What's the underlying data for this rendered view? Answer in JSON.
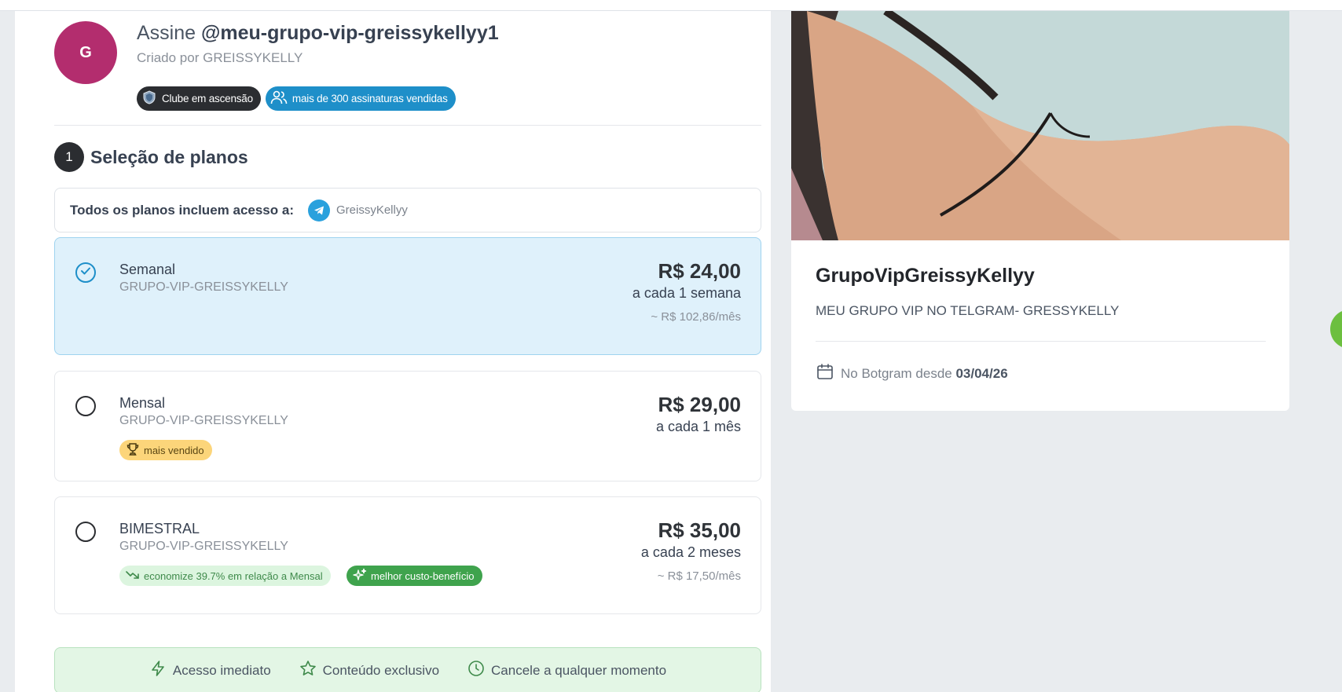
{
  "header": {
    "avatar_letter": "G",
    "title_prefix": "Assine ",
    "title_handle": "@meu-grupo-vip-greissykellyy1",
    "creator": "Criado por GREISSYKELLY",
    "badges": [
      {
        "label": "Clube em ascensão",
        "icon": "shield-icon",
        "color": "#2b2d31"
      },
      {
        "label": "mais de 300 assinaturas vendidas",
        "icon": "users-icon",
        "color": "#1e8fc9"
      }
    ]
  },
  "plans_section": {
    "step_number": "1",
    "title": "Seleção de planos",
    "access_label": "Todos os planos incluem acesso a:",
    "access_item": "GreissyKellyy",
    "access_icon": "telegram-icon"
  },
  "plans": [
    {
      "name": "Semanal",
      "group": "GRUPO-VIP-GREISSYKELLY",
      "price": "R$ 24,00",
      "period": "a cada 1 semana",
      "monthly": "~ R$ 102,86/mês",
      "selected": true
    },
    {
      "name": "Mensal",
      "group": "GRUPO-VIP-GREISSYKELLY",
      "price": "R$ 29,00",
      "period": "a cada 1 mês",
      "tag": "mais vendido",
      "selected": false
    },
    {
      "name": "BIMESTRAL",
      "group": "GRUPO-VIP-GREISSYKELLY",
      "price": "R$ 35,00",
      "period": "a cada 2 meses",
      "monthly": "~ R$ 17,50/mês",
      "tag_savings": "economize 39.7% em relação a Mensal",
      "tag_best": "melhor custo-benefício",
      "selected": false
    }
  ],
  "features": [
    {
      "label": "Acesso imediato",
      "icon": "bolt-icon"
    },
    {
      "label": "Conteúdo exclusivo",
      "icon": "star-icon"
    },
    {
      "label": "Cancele a qualquer momento",
      "icon": "clock-icon"
    }
  ],
  "card": {
    "name": "GrupoVipGreissyKellyy",
    "description": "MEU GRUPO VIP NO TELGRAM- GRESSYKELLY",
    "since_label": "No Botgram desde ",
    "since_date": "03/04/26"
  },
  "colors": {
    "accent_blue": "#1e8fc9",
    "selected_bg": "#dff1fb",
    "avatar": "#b32d6e",
    "success_green": "#3fa34d"
  }
}
